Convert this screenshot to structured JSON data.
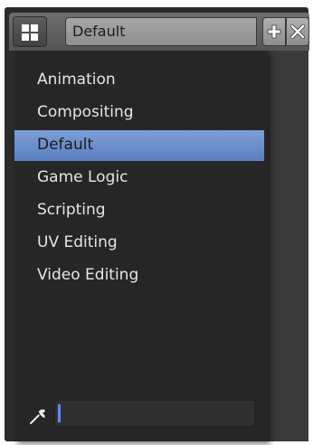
{
  "header": {
    "screen_layout_value": "Default",
    "layout_icon": "screen-layout-grid-icon",
    "add_icon": "plus-icon",
    "remove_icon": "close-icon"
  },
  "menu": {
    "items": [
      {
        "label": "Animation",
        "selected": false
      },
      {
        "label": "Compositing",
        "selected": false
      },
      {
        "label": "Default",
        "selected": true
      },
      {
        "label": "Game Logic",
        "selected": false
      },
      {
        "label": "Scripting",
        "selected": false
      },
      {
        "label": "UV Editing",
        "selected": false
      },
      {
        "label": "Video Editing",
        "selected": false
      }
    ],
    "search": {
      "icon": "search-icon",
      "value": ""
    }
  },
  "colors": {
    "selection": "#6a8ecf",
    "menu_background": "#262626",
    "menu_text": "#e6e6e6"
  }
}
